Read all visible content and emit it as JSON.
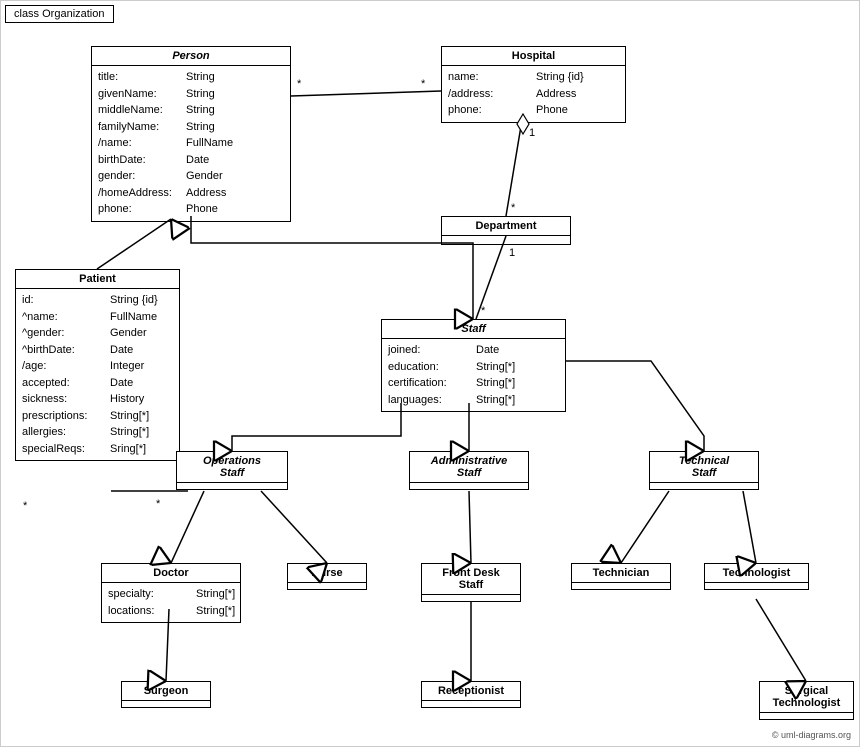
{
  "title": "class Organization",
  "copyright": "© uml-diagrams.org",
  "classes": {
    "person": {
      "name": "Person",
      "italic": true,
      "attrs": [
        [
          "title:",
          "String"
        ],
        [
          "givenName:",
          "String"
        ],
        [
          "middleName:",
          "String"
        ],
        [
          "familyName:",
          "String"
        ],
        [
          "/name:",
          "FullName"
        ],
        [
          "birthDate:",
          "Date"
        ],
        [
          "gender:",
          "Gender"
        ],
        [
          "/homeAddress:",
          "Address"
        ],
        [
          "phone:",
          "Phone"
        ]
      ]
    },
    "hospital": {
      "name": "Hospital",
      "italic": false,
      "attrs": [
        [
          "name:",
          "String {id}"
        ],
        [
          "/address:",
          "Address"
        ],
        [
          "phone:",
          "Phone"
        ]
      ]
    },
    "department": {
      "name": "Department",
      "italic": false,
      "attrs": []
    },
    "staff": {
      "name": "Staff",
      "italic": true,
      "attrs": [
        [
          "joined:",
          "Date"
        ],
        [
          "education:",
          "String[*]"
        ],
        [
          "certification:",
          "String[*]"
        ],
        [
          "languages:",
          "String[*]"
        ]
      ]
    },
    "patient": {
      "name": "Patient",
      "italic": false,
      "attrs": [
        [
          "id:",
          "String {id}"
        ],
        [
          "^name:",
          "FullName"
        ],
        [
          "^gender:",
          "Gender"
        ],
        [
          "^birthDate:",
          "Date"
        ],
        [
          "/age:",
          "Integer"
        ],
        [
          "accepted:",
          "Date"
        ],
        [
          "sickness:",
          "History"
        ],
        [
          "prescriptions:",
          "String[*]"
        ],
        [
          "allergies:",
          "String[*]"
        ],
        [
          "specialReqs:",
          "Sring[*]"
        ]
      ]
    },
    "operations_staff": {
      "name": "Operations\nStaff",
      "italic": true,
      "attrs": []
    },
    "administrative_staff": {
      "name": "Administrative\nStaff",
      "italic": true,
      "attrs": []
    },
    "technical_staff": {
      "name": "Technical\nStaff",
      "italic": true,
      "attrs": []
    },
    "doctor": {
      "name": "Doctor",
      "italic": false,
      "attrs": [
        [
          "specialty:",
          "String[*]"
        ],
        [
          "locations:",
          "String[*]"
        ]
      ]
    },
    "nurse": {
      "name": "Nurse",
      "italic": false,
      "attrs": []
    },
    "front_desk_staff": {
      "name": "Front Desk\nStaff",
      "italic": false,
      "attrs": []
    },
    "technician": {
      "name": "Technician",
      "italic": false,
      "attrs": []
    },
    "technologist": {
      "name": "Technologist",
      "italic": false,
      "attrs": []
    },
    "surgeon": {
      "name": "Surgeon",
      "italic": false,
      "attrs": []
    },
    "receptionist": {
      "name": "Receptionist",
      "italic": false,
      "attrs": []
    },
    "surgical_technologist": {
      "name": "Surgical\nTechnologist",
      "italic": false,
      "attrs": []
    }
  }
}
